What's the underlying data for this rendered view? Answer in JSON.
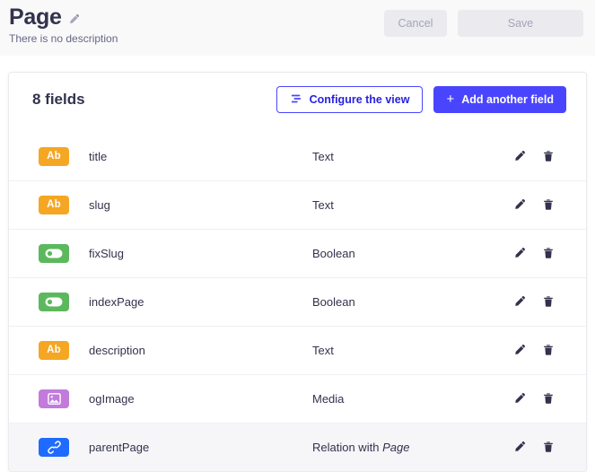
{
  "header": {
    "title": "Page",
    "edit_icon": "pencil-icon",
    "subtitle": "There is no description",
    "cancel_label": "Cancel",
    "save_label": "Save"
  },
  "card": {
    "fields_count_label": "8 fields",
    "configure_label": "Configure the view",
    "configure_icon": "sliders-icon",
    "add_field_label": "Add another field",
    "add_field_icon": "plus-icon",
    "edit_row_icon": "pencil-icon",
    "delete_row_icon": "trash-icon"
  },
  "colors": {
    "accent_blue": "#4945ff",
    "primary_blue": "#1f6bff",
    "badge_text": "#f5a623",
    "badge_boolean": "#5cb85c",
    "badge_media": "#c27bdb",
    "badge_relation": "#1f6bff",
    "header_bg": "#f9f9fa",
    "row_highlight": "#f6f6f9"
  },
  "fields": [
    {
      "name": "title",
      "type": "Text",
      "type_suffix": "",
      "badge_kind": "text",
      "badge_label": "Ab",
      "highlighted": false
    },
    {
      "name": "slug",
      "type": "Text",
      "type_suffix": "",
      "badge_kind": "text",
      "badge_label": "Ab",
      "highlighted": false
    },
    {
      "name": "fixSlug",
      "type": "Boolean",
      "type_suffix": "",
      "badge_kind": "boolean",
      "badge_label": "",
      "highlighted": false
    },
    {
      "name": "indexPage",
      "type": "Boolean",
      "type_suffix": "",
      "badge_kind": "boolean",
      "badge_label": "",
      "highlighted": false
    },
    {
      "name": "description",
      "type": "Text",
      "type_suffix": "",
      "badge_kind": "text",
      "badge_label": "Ab",
      "highlighted": false
    },
    {
      "name": "ogImage",
      "type": "Media",
      "type_suffix": "",
      "badge_kind": "media",
      "badge_label": "",
      "highlighted": false
    },
    {
      "name": "parentPage",
      "type": "Relation with",
      "type_suffix": "Page",
      "badge_kind": "relation",
      "badge_label": "",
      "highlighted": true
    }
  ]
}
